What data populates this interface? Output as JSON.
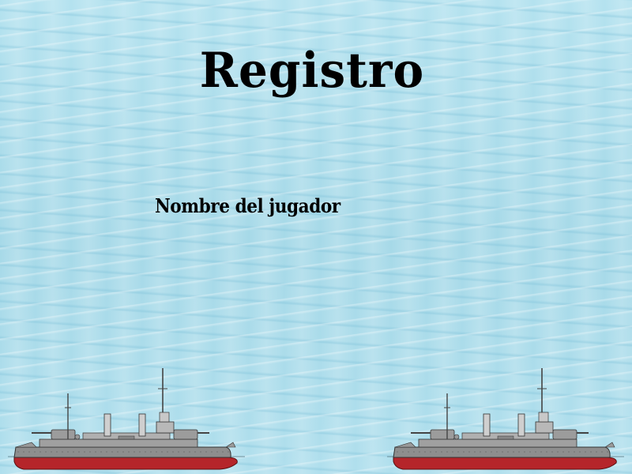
{
  "screen": {
    "title": "Registro",
    "player_name_label": "Nombre del jugador"
  },
  "decorations": {
    "ships": [
      {
        "name": "battleship-left-icon"
      },
      {
        "name": "battleship-right-icon"
      }
    ]
  },
  "colors": {
    "water": "#a9dcea",
    "hull_red": "#b5252a",
    "hull_gray": "#8e8e8e",
    "text": "#000000"
  }
}
